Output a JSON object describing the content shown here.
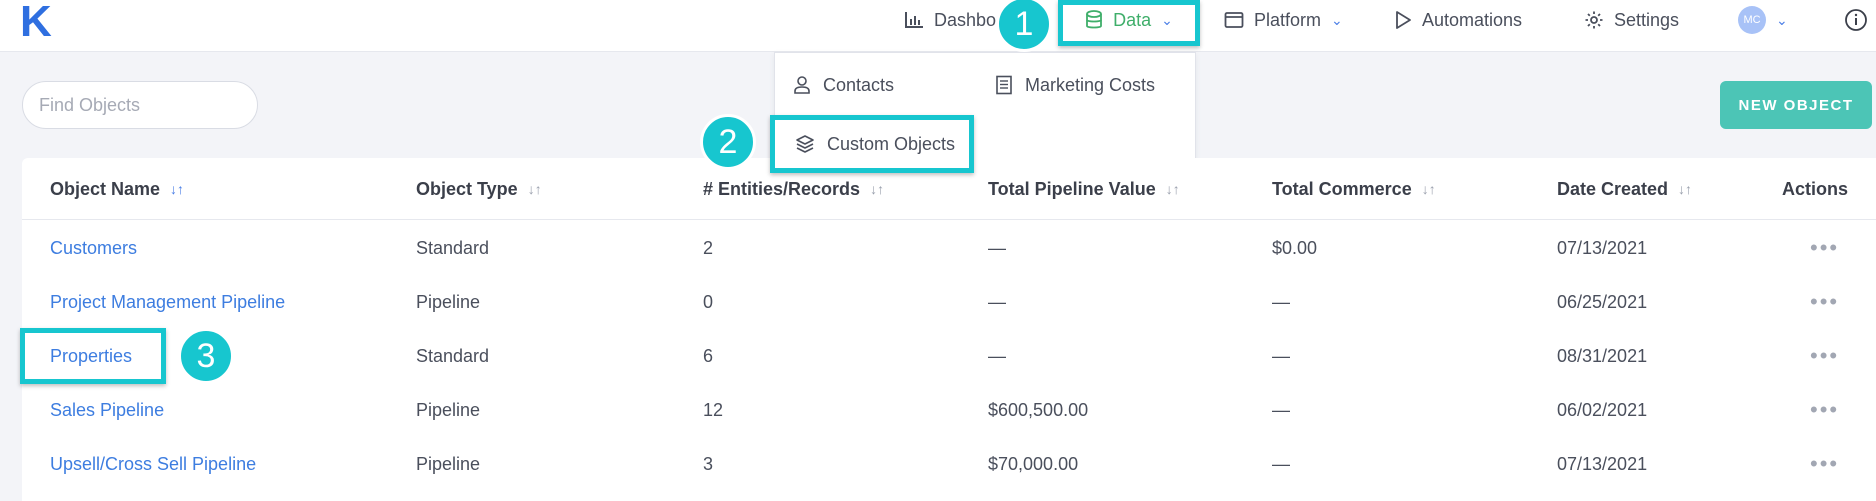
{
  "logo": "K",
  "nav": {
    "dashboard": "Dashbo",
    "data": "Data",
    "platform": "Platform",
    "automations": "Automations",
    "settings": "Settings",
    "avatar_initials": "MC"
  },
  "data_menu": {
    "contacts": "Contacts",
    "marketing_costs": "Marketing Costs",
    "custom_objects": "Custom Objects"
  },
  "steps": [
    "1",
    "2",
    "3"
  ],
  "search": {
    "placeholder": "Find Objects"
  },
  "new_object_label": "NEW OBJECT",
  "columns": [
    "Object Name",
    "Object Type",
    "# Entities/Records",
    "Total Pipeline Value",
    "Total Commerce",
    "Date Created",
    "Actions"
  ],
  "rows": [
    [
      "Customers",
      "Standard",
      "2",
      "—",
      "$0.00",
      "07/13/2021"
    ],
    [
      "Project Management Pipeline",
      "Pipeline",
      "0",
      "—",
      "—",
      "06/25/2021"
    ],
    [
      "Properties",
      "Standard",
      "6",
      "—",
      "—",
      "08/31/2021"
    ],
    [
      "Sales Pipeline",
      "Pipeline",
      "12",
      "$600,500.00",
      "—",
      "06/02/2021"
    ],
    [
      "Upsell/Cross Sell Pipeline",
      "Pipeline",
      "3",
      "$70,000.00",
      "—",
      "07/13/2021"
    ]
  ],
  "colors": {
    "accent_teal": "#17c6cf",
    "link_blue": "#3d7de0",
    "data_green": "#3fae6a",
    "button_teal": "#4cc5b6"
  }
}
